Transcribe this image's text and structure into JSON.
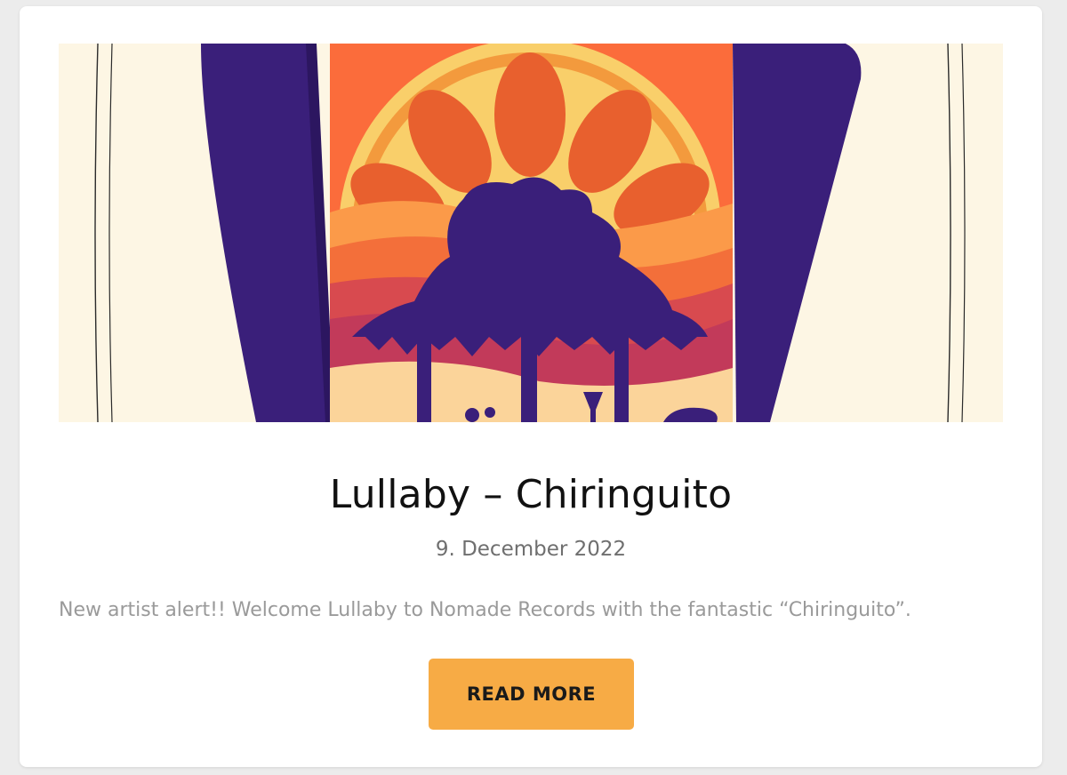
{
  "post": {
    "image": {
      "alt": "",
      "artwork": "tropical-sunset-hut-illustration"
    },
    "title": "Lullaby – Chiringuito",
    "date": "9. December 2022",
    "excerpt": "New artist alert!! Welcome Lullaby to Nomade Records with the fantastic “Chiringuito”.",
    "read_more_label": "READ MORE"
  },
  "colors": {
    "button": "#f7ab45",
    "purple": "#3a1f7a",
    "orange": "#fb6c3b"
  }
}
